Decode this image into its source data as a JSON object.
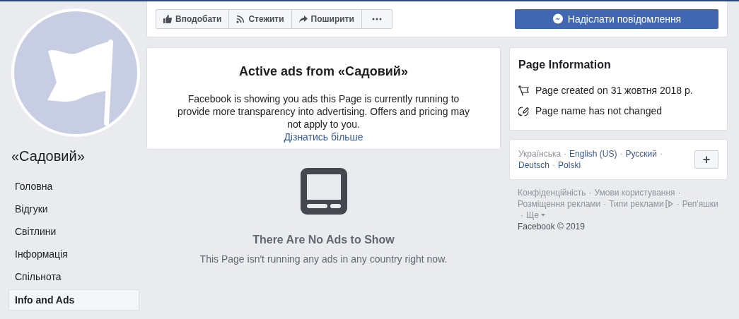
{
  "page": {
    "name": "«Садовий»"
  },
  "sidebar": {
    "items": [
      {
        "label": "Головна",
        "selected": false
      },
      {
        "label": "Відгуки",
        "selected": false
      },
      {
        "label": "Світлини",
        "selected": false
      },
      {
        "label": "Інформація",
        "selected": false
      },
      {
        "label": "Спільнота",
        "selected": false
      },
      {
        "label": "Info and Ads",
        "selected": true
      }
    ]
  },
  "action_bar": {
    "buttons": [
      {
        "kind": "like",
        "label": "Вподобати"
      },
      {
        "kind": "follow",
        "label": "Стежити"
      },
      {
        "kind": "share",
        "label": "Поширити"
      },
      {
        "kind": "more"
      }
    ],
    "message_button": "Надіслати повідомлення"
  },
  "ads_card": {
    "title": "Active ads from «Садовий»",
    "description": "Facebook is showing you ads this Page is currently running to provide more transparency into advertising. Offers and pricing may not apply to you.",
    "link": "Дізнатись більше"
  },
  "empty_state": {
    "title": "There Are No Ads to Show",
    "subtitle": "This Page isn't running any ads in any country right now."
  },
  "page_information": {
    "title": "Page Information",
    "rows": [
      {
        "kind": "created",
        "text": "Page created on 31 жовтня 2018 р."
      },
      {
        "kind": "name",
        "text": "Page name has not changed"
      }
    ]
  },
  "languages": {
    "separator": "·",
    "items": [
      {
        "label": "Українська",
        "selected": true
      },
      {
        "label": "English (US)",
        "selected": false
      },
      {
        "label": "Русский",
        "selected": false
      },
      {
        "label": "Deutsch",
        "selected": false
      },
      {
        "label": "Polski",
        "selected": false
      }
    ],
    "add_button": "+"
  },
  "footer": {
    "separator": "·",
    "links": [
      {
        "kind": "link",
        "label": "Конфіденційність"
      },
      {
        "kind": "link",
        "label": "Умови користування"
      },
      {
        "kind": "link",
        "label": "Розміщення реклами"
      },
      {
        "kind": "adchoices",
        "label": "Типи реклами"
      },
      {
        "kind": "link",
        "label": "Реп'яшки"
      },
      {
        "kind": "menu",
        "label": "Ще"
      }
    ],
    "copyright": "Facebook © 2019"
  }
}
